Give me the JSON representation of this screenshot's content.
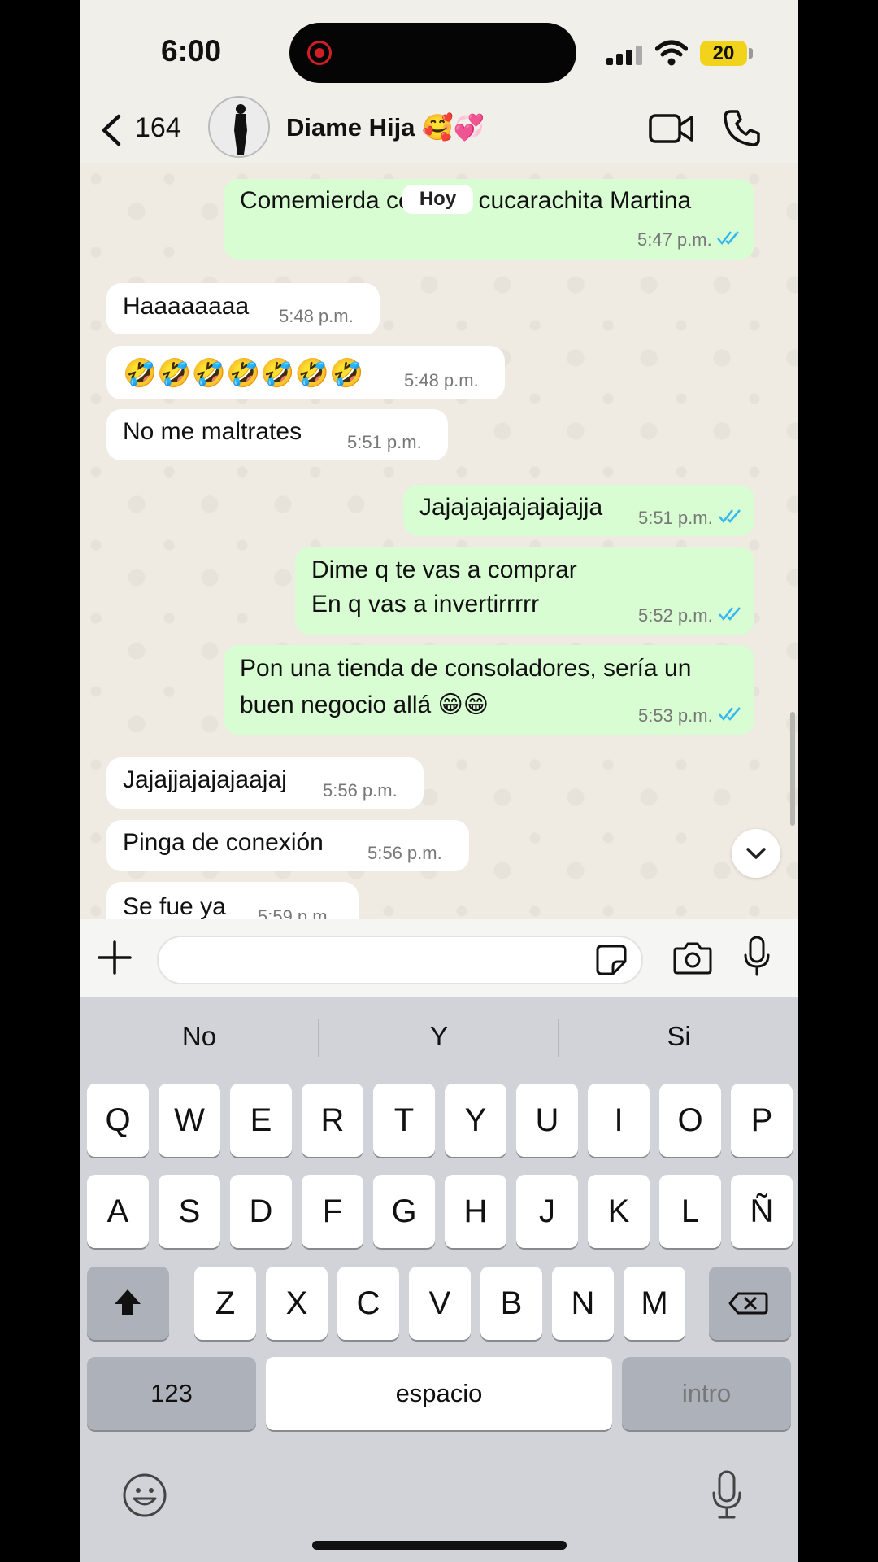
{
  "status": {
    "time": "6:00",
    "battery": "20"
  },
  "header": {
    "back_count": "164",
    "contact_name": "Diame Hija 🥰💞"
  },
  "chat": {
    "day_chip": "Hoy",
    "messages": [
      {
        "dir": "out",
        "lines": [
          "Comemierda como la cucarachita Martina"
        ],
        "time": "5:47 p.m.",
        "read": true
      },
      {
        "dir": "in",
        "lines": [
          "Haaaaaaaa"
        ],
        "time": "5:48 p.m."
      },
      {
        "dir": "in",
        "lines": [
          "🤣🤣🤣🤣🤣🤣🤣"
        ],
        "time": "5:48 p.m."
      },
      {
        "dir": "in",
        "lines": [
          "No me maltrates"
        ],
        "time": "5:51 p.m."
      },
      {
        "dir": "out",
        "lines": [
          "Jajajajajajajajajja"
        ],
        "time": "5:51 p.m.",
        "read": true
      },
      {
        "dir": "out",
        "lines": [
          "Dime q te vas a comprar",
          "En q vas a invertirrrrr"
        ],
        "time": "5:52 p.m.",
        "read": true
      },
      {
        "dir": "out",
        "lines": [
          "Pon una tienda de consoladores, sería un",
          "buen negocio allá 😁😁"
        ],
        "time": "5:53 p.m.",
        "read": true
      },
      {
        "dir": "in",
        "lines": [
          "Jajajjajajajaajaj"
        ],
        "time": "5:56 p.m."
      },
      {
        "dir": "in",
        "lines": [
          "Pinga de conexión"
        ],
        "time": "5:56 p.m."
      },
      {
        "dir": "in",
        "lines": [
          "Se fue ya"
        ],
        "time": "5:59 p.m."
      }
    ]
  },
  "input": {
    "placeholder": "",
    "value": ""
  },
  "keyboard": {
    "suggestions": [
      "No",
      "Y",
      "Si"
    ],
    "rows": [
      [
        "Q",
        "W",
        "E",
        "R",
        "T",
        "Y",
        "U",
        "I",
        "O",
        "P"
      ],
      [
        "A",
        "S",
        "D",
        "F",
        "G",
        "H",
        "J",
        "K",
        "L",
        "Ñ"
      ],
      [
        "Z",
        "X",
        "C",
        "V",
        "B",
        "N",
        "M"
      ]
    ],
    "numbers_label": "123",
    "space_label": "espacio",
    "return_label": "intro"
  },
  "colors": {
    "outgoing_bubble": "#d9fdd3",
    "incoming_bubble": "#ffffff",
    "read_ticks": "#34b7f1",
    "recording": "#d01f25"
  }
}
